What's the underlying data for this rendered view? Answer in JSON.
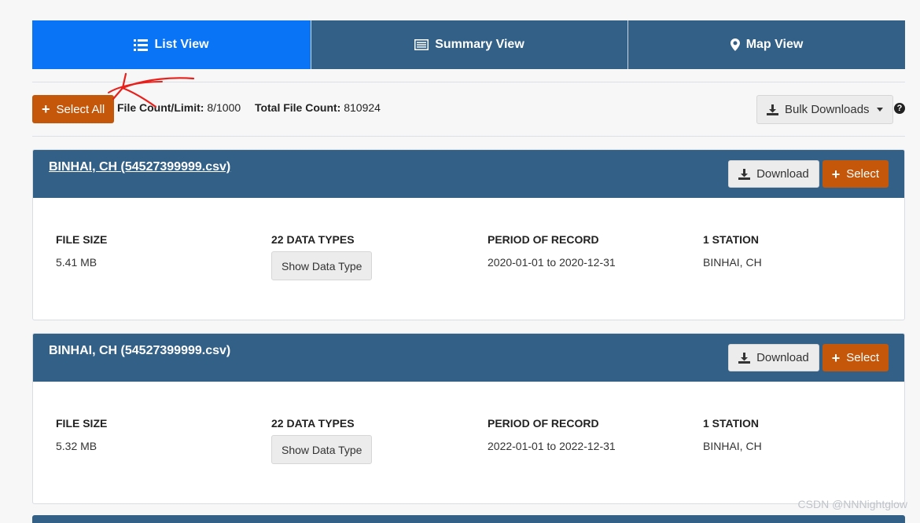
{
  "tabs": [
    {
      "label": "List View",
      "icon": "list-icon",
      "active": true
    },
    {
      "label": "Summary View",
      "icon": "summary-icon",
      "active": false
    },
    {
      "label": "Map View",
      "icon": "map-marker-icon",
      "active": false
    }
  ],
  "toolbar": {
    "select_all_label": "Select All",
    "file_count_label": "File Count/Limit:",
    "file_count_value": "8/1000",
    "total_count_label": "Total File Count:",
    "total_count_value": "810924",
    "bulk_label": "Bulk Downloads",
    "help_label": "?"
  },
  "columns": {
    "file_size": "FILE SIZE",
    "data_types": "22 DATA TYPES",
    "period": "PERIOD OF RECORD",
    "stations": "1 STATION",
    "show_data_type": "Show Data Type"
  },
  "card_actions": {
    "download_label": "Download",
    "select_label": "Select"
  },
  "cards": [
    {
      "title": "BINHAI, CH (54527399999.csv)",
      "file_size": "5.41 MB",
      "period": "2020-01-01 to 2020-12-31",
      "station": "BINHAI, CH"
    },
    {
      "title": "BINHAI, CH (54527399999.csv)",
      "file_size": "5.32 MB",
      "period": "2022-01-01 to 2022-12-31",
      "station": "BINHAI, CH"
    }
  ],
  "watermark": "CSDN @NNNightglow",
  "colors": {
    "active_tab": "#0a74f7",
    "header_blue": "#336087",
    "orange": "#c4570a",
    "annotation_red": "#e8201b"
  }
}
